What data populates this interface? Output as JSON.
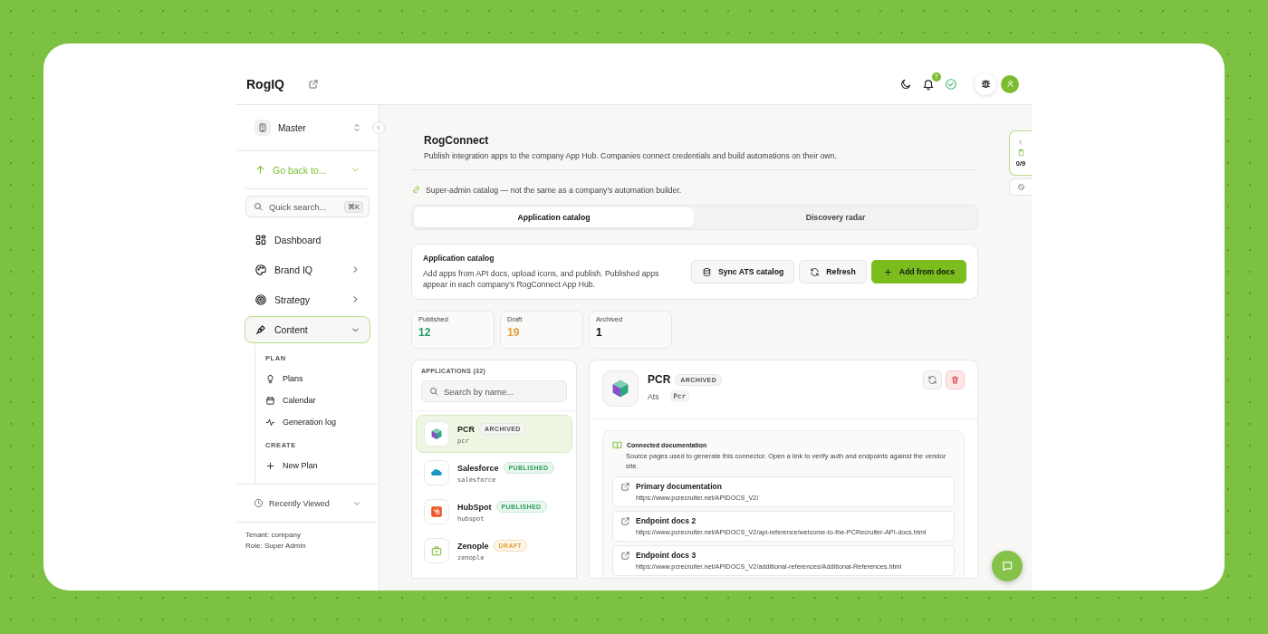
{
  "brand": "RogIQ",
  "header": {
    "notifications": "7"
  },
  "sidebar": {
    "workspace": "Master",
    "go_back": "Go back to...",
    "search": {
      "placeholder": "Quick search...",
      "shortcut": "⌘K"
    },
    "nav": [
      {
        "label": "Dashboard",
        "kind": "link",
        "selected": false
      },
      {
        "label": "Brand IQ",
        "kind": "group",
        "selected": false,
        "expanded": false
      },
      {
        "label": "Strategy",
        "kind": "group",
        "selected": false,
        "expanded": false
      },
      {
        "label": "Content",
        "kind": "group",
        "selected": true,
        "expanded": true,
        "children": [
          {
            "heading": "PLAN",
            "items": [
              "Plans",
              "Calendar",
              "Generation log"
            ]
          },
          {
            "heading": "CREATE",
            "items": [
              "New Plan"
            ]
          }
        ]
      }
    ],
    "recently_viewed": {
      "label": "Recently Viewed",
      "expanded": false
    },
    "footer": [
      "Tenant: company",
      "Role: Super Admin"
    ]
  },
  "main": {
    "title": "RogConnect",
    "subtitle": "Publish integration apps to the company App Hub. Companies connect credentials and build automations on their own.",
    "notice": "Super-admin catalog — not the same as a company's automation builder.",
    "tabs": [
      {
        "label": "Application catalog",
        "selected": true
      },
      {
        "label": "Discovery radar",
        "selected": false
      }
    ],
    "catalog": {
      "title": "Application catalog",
      "description": "Add apps from API docs, upload icons, and publish. Published apps appear in each company's RogConnect App Hub.",
      "buttons": [
        {
          "label": "Sync ATS catalog",
          "kind": "secondary"
        },
        {
          "label": "Refresh",
          "kind": "secondary"
        },
        {
          "label": "Add from docs",
          "kind": "primary"
        }
      ]
    },
    "stats": [
      {
        "label": "Published",
        "value": "12",
        "color": "#1f9d63"
      },
      {
        "label": "Draft",
        "value": "19",
        "color": "#e3a13b"
      },
      {
        "label": "Archived",
        "value": "1",
        "color": "#111111"
      }
    ],
    "apps": {
      "heading": "APPLICATIONS (32)",
      "search_placeholder": "Search by name...",
      "items": [
        {
          "name": "PCR",
          "slug": "pcr",
          "status": "ARCHIVED",
          "kind": "archived",
          "selected": true
        },
        {
          "name": "Salesforce",
          "slug": "salesforce",
          "status": "PUBLISHED",
          "kind": "published",
          "selected": false
        },
        {
          "name": "HubSpot",
          "slug": "hubspot",
          "status": "PUBLISHED",
          "kind": "published",
          "selected": false
        },
        {
          "name": "Zenople",
          "slug": "zenople",
          "status": "DRAFT",
          "kind": "draft",
          "selected": false
        }
      ]
    },
    "detail": {
      "name": "PCR",
      "status": "ARCHIVED",
      "kind": "archived",
      "category": "Ats",
      "tag": "Pcr",
      "docs": {
        "title": "Connected documentation",
        "description": "Source pages used to generate this connector. Open a link to verify auth and endpoints against the vendor site.",
        "links": [
          {
            "title": "Primary documentation",
            "url": "https://www.pcrecruiter.net/APIDOCS_V2/"
          },
          {
            "title": "Endpoint docs 2",
            "url": "https://www.pcrecruiter.net/APIDOCS_V2/api-reference/welcome-to-the-PCRecruiter-API-docs.html"
          },
          {
            "title": "Endpoint docs 3",
            "url": "https://www.pcrecruiter.net/APIDOCS_V2/additional-references/Additional-References.html"
          }
        ]
      }
    }
  },
  "rail": {
    "progress": "0/9"
  }
}
